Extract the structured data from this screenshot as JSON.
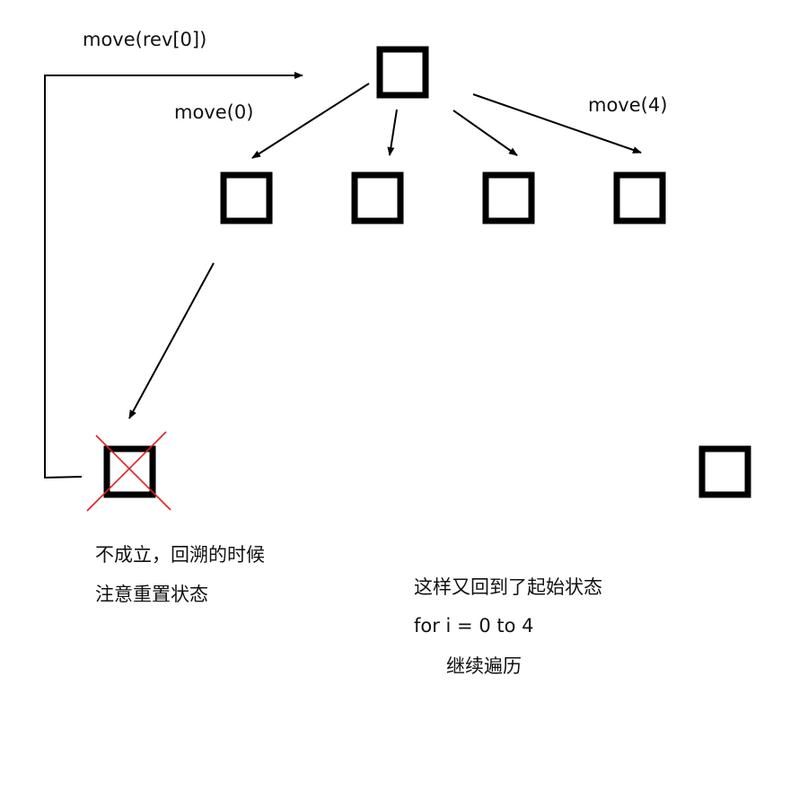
{
  "labels": {
    "move_rev": "move(rev[0])",
    "move_first": "move(0)",
    "move_last": "move(4)"
  },
  "notes": {
    "fail_line1": "不成立，回溯的时候",
    "fail_line2": "注意重置状态",
    "back_line1": "这样又回到了起始状态",
    "back_line2": "for i = 0 to 4",
    "back_line3": "继续遍历"
  },
  "colors": {
    "node": "#000000",
    "edge": "#000000",
    "cross": "#e02020"
  }
}
